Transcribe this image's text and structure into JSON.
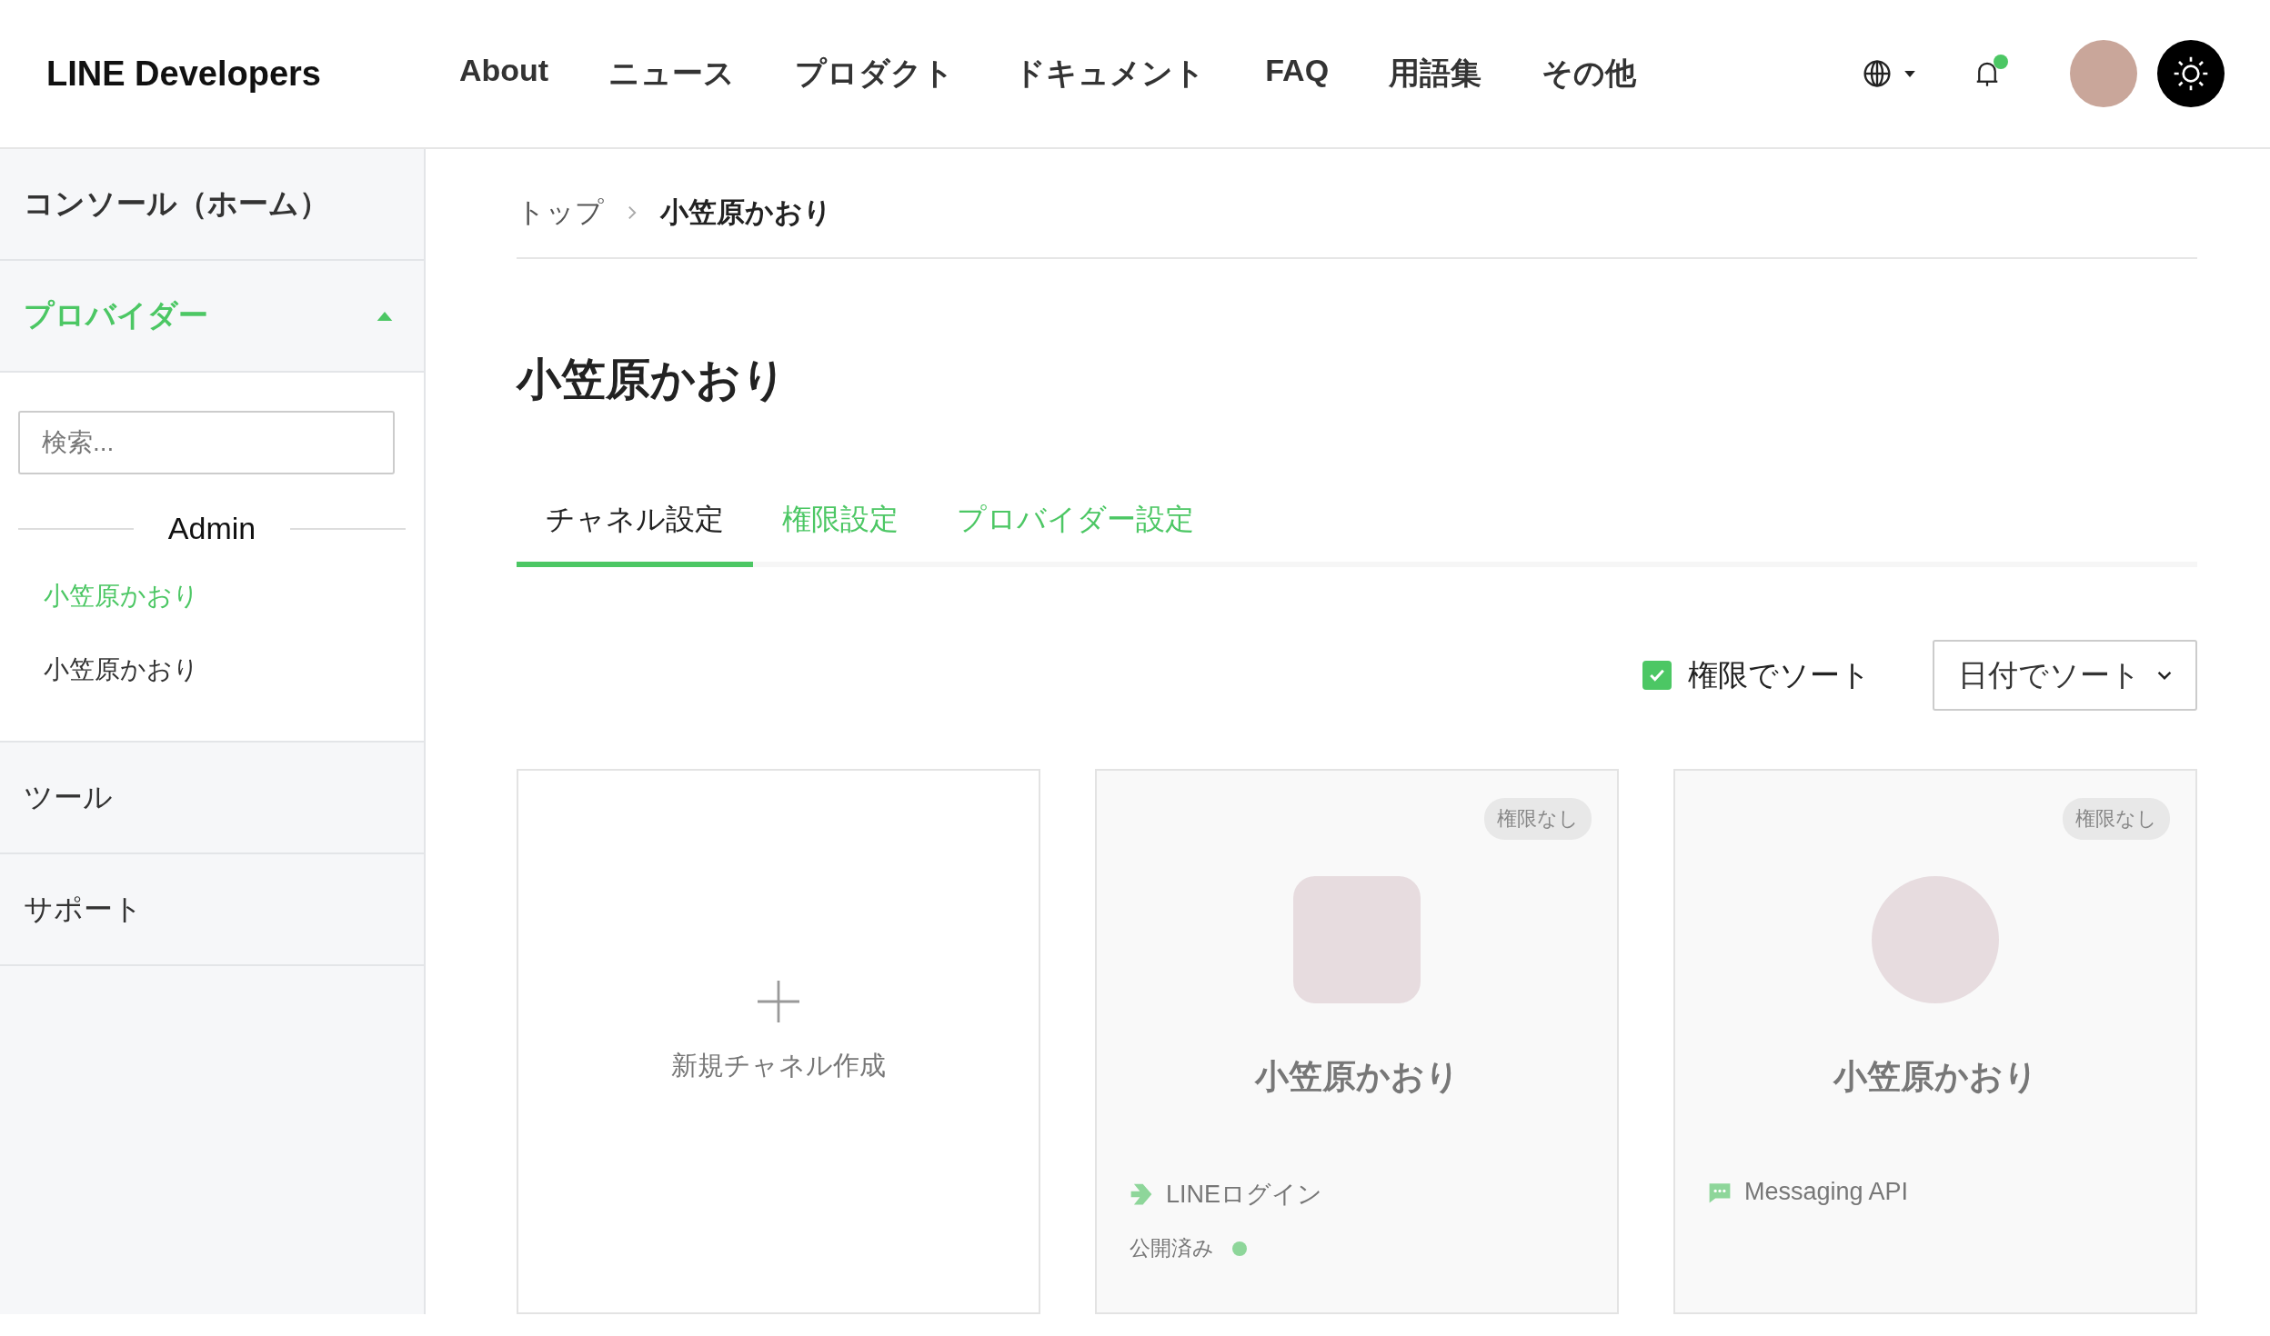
{
  "header": {
    "logo": "LINE Developers",
    "nav": [
      {
        "label": "About"
      },
      {
        "label": "ニュース"
      },
      {
        "label": "プロダクト"
      },
      {
        "label": "ドキュメント"
      },
      {
        "label": "FAQ"
      },
      {
        "label": "用語集"
      },
      {
        "label": "その他"
      }
    ],
    "has_notification": true
  },
  "sidebar": {
    "home": "コンソール（ホーム）",
    "provider_section": {
      "label": "プロバイダー",
      "expanded": true,
      "search": {
        "placeholder": "検索..."
      },
      "group_label": "Admin",
      "items": [
        {
          "label": "小笠原かおり",
          "selected": true
        },
        {
          "label": "小笠原かおり",
          "selected": false
        }
      ]
    },
    "items": [
      {
        "label": "ツール"
      },
      {
        "label": "サポート"
      }
    ]
  },
  "breadcrumb": [
    {
      "label": "トップ"
    },
    {
      "label": "小笠原かおり"
    }
  ],
  "title": "小笠原かおり",
  "tabs": [
    {
      "label": "チャネル設定",
      "selected": true
    },
    {
      "label": "権限設定",
      "selected": false
    },
    {
      "label": "プロバイダー設定",
      "selected": false
    }
  ],
  "sort": {
    "checkbox": {
      "label": "権限でソート",
      "checked": true
    },
    "dropdown": {
      "value": "日付でソート"
    }
  },
  "channels": [
    {
      "kind": "new",
      "label": "新規チャネル作成"
    },
    {
      "kind": "login",
      "badge": "権限なし",
      "name": "小笠原かおり",
      "type_label": "LINEログイン",
      "status": {
        "label": "公開済み",
        "color": "#8ed69a"
      }
    },
    {
      "kind": "messaging",
      "badge": "権限なし",
      "name": "小笠原かおり",
      "type_label": "Messaging API"
    }
  ]
}
